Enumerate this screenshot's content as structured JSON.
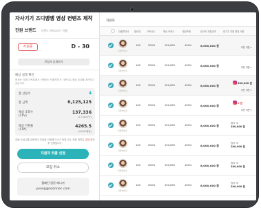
{
  "left": {
    "title": "자사기기 즈디뱅뱅 영상 컨텐츠 제작",
    "brand": "진원 브랜드",
    "brand_meta": "브랜드 카테고리 | 이름",
    "status_badge": "지원중",
    "dday": "D - 30",
    "detail_button": "모집서 상세보기",
    "section_title": "예상 성과 확인",
    "section_desc": "현재는 지원자 목록에서 선택하신 인플루언서 기준으로 예상 성과를 계산하고 있습니다.",
    "stats": [
      {
        "label": "총 선정수",
        "value": "4"
      },
      {
        "label": "총 금액",
        "value": "6,125,125"
      },
      {
        "label": "예상 조회수 (CPV)",
        "value": "137,336",
        "sub": "(2,736/CPV)"
      },
      {
        "label": "예상 전환율 (CPA)",
        "value": "4265.5",
        "sub": "(40000원당)"
      }
    ],
    "note_text": "예상 도달수를 검토하여 모집을 선정해 주시기 바랍니다. 최종 계약은",
    "note_highlight": "결제",
    "note_tail": "확인 후 진행됩니다.",
    "select_button": "지원자 최종 선정",
    "cancel_button": "모집 취소",
    "contact_title": "캠페인 담당 매니저",
    "contact_email": "young@ozonnec.com"
  },
  "right": {
    "header_title": "지원자",
    "columns": [
      "인플루언서",
      "팔로워",
      "구독자수",
      "예상 조회수",
      "평균조회",
      "광고비 지원금액",
      "광고주 지원 변경 사항"
    ],
    "rows": [
      {
        "name": "인플루언서",
        "followers": "100",
        "subs": "200%",
        "views": "150,000",
        "avg": "100%",
        "price": "6,000,000 원",
        "extra_label": "",
        "extra_value": "",
        "dropdown": "추천 다운 ▾",
        "shaded": true
      },
      {
        "name": "인플루언서",
        "followers": "100",
        "subs": "200%",
        "views": "150,000",
        "avg": "100%",
        "price": "6,000,000 원",
        "extra_label": "",
        "extra_value": "",
        "dropdown": "추천 다운 ▾",
        "shaded": false
      },
      {
        "name": "인플루언서",
        "followers": "100",
        "subs": "200%",
        "views": "150,000",
        "avg": "100%",
        "price": "6,000,000 원",
        "extra_label": "",
        "extra_value": "300,000 원",
        "dropdown": "추천 다운 ▾",
        "shaded": true,
        "ig": true
      },
      {
        "name": "인플루언서",
        "followers": "100",
        "subs": "200%",
        "views": "150,000",
        "avg": "100%",
        "price": "6,000,000 원",
        "extra_label": "",
        "extra_value": "0 원",
        "dropdown": "추천 다운 ▾",
        "shaded": false,
        "ig": true,
        "red": true
      },
      {
        "name": "인플루언서",
        "followers": "100",
        "subs": "200%",
        "views": "150,000",
        "avg": "100%",
        "price": "6,000,000 원",
        "extra_label": "협의 후",
        "extra_value": "200,000 원",
        "dropdown": "",
        "shaded": false
      },
      {
        "name": "인플루언서",
        "followers": "100",
        "subs": "200%",
        "views": "150,000",
        "avg": "100%",
        "price": "6,000,000 원",
        "extra_label": "협의 후",
        "extra_value": "200,000 원",
        "dropdown": "",
        "shaded": false
      },
      {
        "name": "인플루언서",
        "followers": "100",
        "subs": "200%",
        "views": "150,000",
        "avg": "100%",
        "price": "6,000,000 원",
        "extra_label": "협의 후",
        "extra_value": "200,000 원",
        "dropdown": "",
        "shaded": false
      },
      {
        "name": "인플루언서",
        "followers": "100",
        "subs": "200%",
        "views": "150,000",
        "avg": "100%",
        "price": "6,000,000 원",
        "extra_label": "협의 후",
        "extra_value": "200,000 원",
        "dropdown": "",
        "shaded": false
      }
    ]
  },
  "colors": {
    "accent": "#2bb3b9",
    "danger": "#e75a5a",
    "checkbox": "#3aa8b8"
  }
}
